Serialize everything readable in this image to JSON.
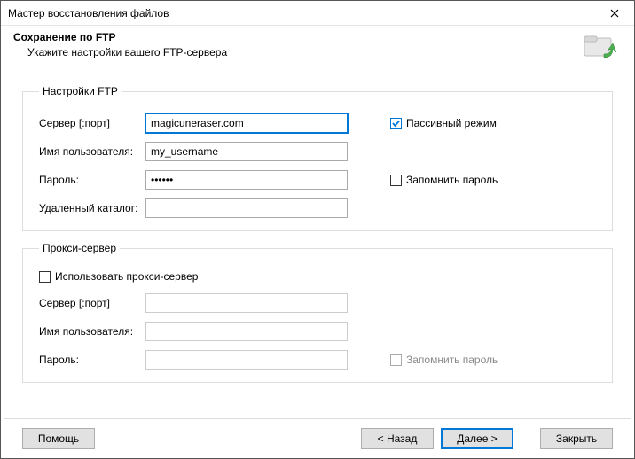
{
  "window": {
    "title": "Мастер восстановления файлов"
  },
  "header": {
    "title": "Сохранение по FTP",
    "subtitle": "Укажите настройки вашего FTP-сервера"
  },
  "ftp": {
    "legend": "Настройки FTP",
    "server_label": "Сервер [:порт]",
    "server_value": "magicuneraser.com",
    "user_label": "Имя пользователя:",
    "user_value": "my_username",
    "pass_label": "Пароль:",
    "pass_value": "••••••",
    "remote_label": "Удаленный каталог:",
    "remote_value": "",
    "passive_label": "Пассивный режим",
    "remember_label": "Запомнить пароль"
  },
  "proxy": {
    "legend": "Прокси-сервер",
    "use_label": "Использовать прокси-сервер",
    "server_label": "Сервер [:порт]",
    "user_label": "Имя пользователя:",
    "pass_label": "Пароль:",
    "remember_label": "Запомнить пароль"
  },
  "buttons": {
    "help": "Помощь",
    "back": "< Назад",
    "next": "Далее >",
    "close": "Закрыть"
  }
}
